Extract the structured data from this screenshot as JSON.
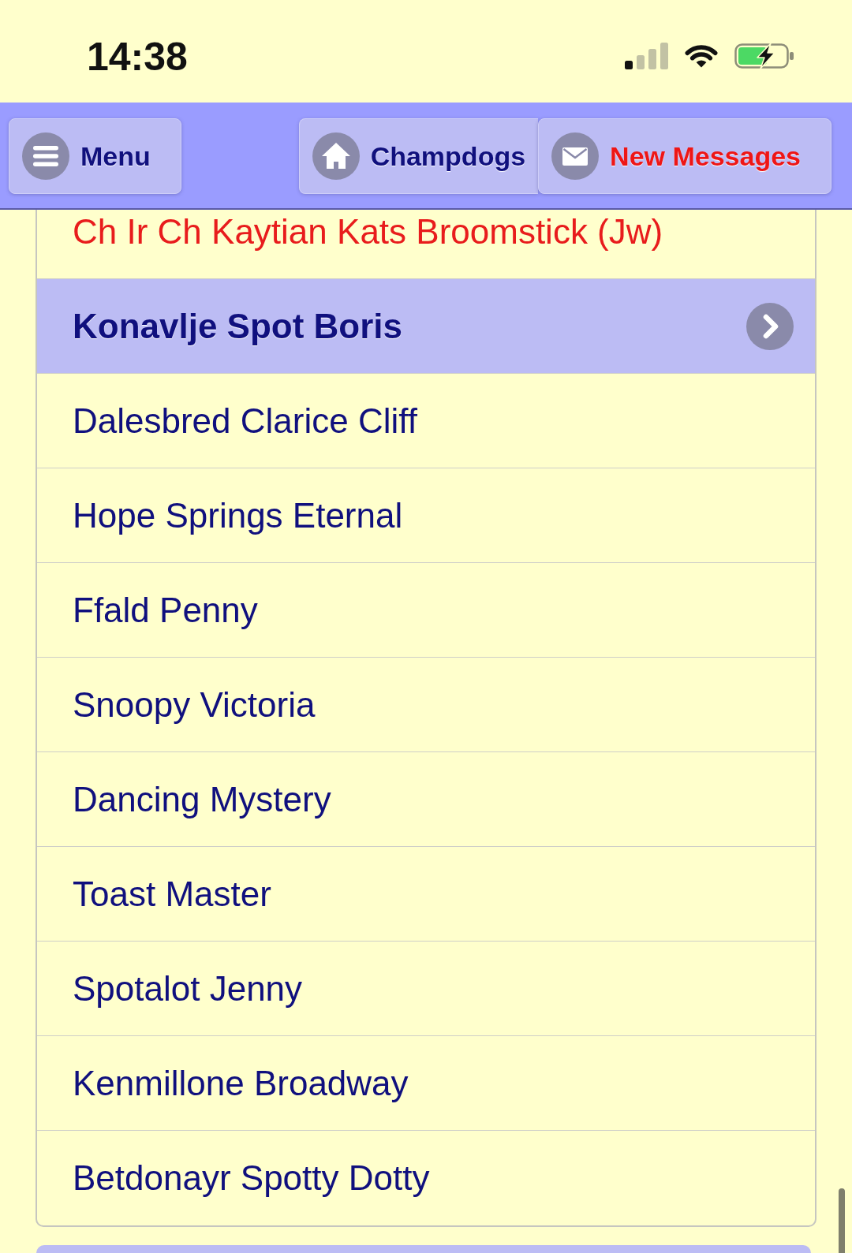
{
  "status_bar": {
    "time": "14:38"
  },
  "header": {
    "buttons": [
      {
        "kind": "menu",
        "label": "Menu",
        "alert": false
      },
      {
        "kind": "home",
        "label": "Champdogs",
        "alert": false
      },
      {
        "kind": "messages",
        "label": "New Messages",
        "alert": true
      }
    ]
  },
  "list": {
    "items": [
      {
        "label": "Ch Ir Ch Kaytian Kats Broomstick (Jw)",
        "color": "#e81c1c",
        "selected": false
      },
      {
        "label": "Konavlje Spot Boris",
        "color": "#10107e",
        "selected": true
      },
      {
        "label": "Dalesbred Clarice Cliff",
        "color": "#10107e",
        "selected": false
      },
      {
        "label": "Hope Springs Eternal",
        "color": "#10107e",
        "selected": false
      },
      {
        "label": "Ffald Penny",
        "color": "#10107e",
        "selected": false
      },
      {
        "label": "Snoopy Victoria",
        "color": "#10107e",
        "selected": false
      },
      {
        "label": "Dancing Mystery",
        "color": "#10107e",
        "selected": false
      },
      {
        "label": "Toast Master",
        "color": "#10107e",
        "selected": false
      },
      {
        "label": "Spotalot Jenny",
        "color": "#10107e",
        "selected": false
      },
      {
        "label": "Kenmillone Broadway",
        "color": "#10107e",
        "selected": false
      },
      {
        "label": "Betdonayr Spotty Dotty",
        "color": "#10107e",
        "selected": false
      }
    ]
  }
}
